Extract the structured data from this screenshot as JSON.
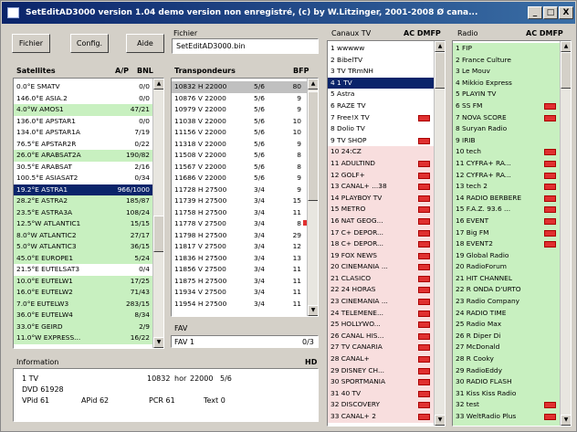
{
  "title": "SetEditAD3000 version 1.04 demo version non enregistré, (c) by W.Litzinger, 2001-2008 Ø cana...",
  "window_controls": {
    "min": "_",
    "max": "□",
    "close": "X"
  },
  "toolbar": {
    "fichier": "Fichier",
    "config": "Config.",
    "aide": "Aide"
  },
  "file": {
    "label": "Fichier",
    "value": "SetEditAD3000.bin"
  },
  "satellites": {
    "header": "Satellites",
    "col_ap": "A/P",
    "col_bl": "BNL",
    "rows": [
      {
        "name": "0.0°E SMATV",
        "value": "0/0",
        "style": ""
      },
      {
        "name": "146.0°E ASIA.2",
        "value": "0/0",
        "style": ""
      },
      {
        "name": "4.0°W AMOS1",
        "value": "47/21",
        "style": "green"
      },
      {
        "name": "136.0°E APSTAR1",
        "value": "0/0",
        "style": ""
      },
      {
        "name": "134.0°E APSTAR1A",
        "value": "7/19",
        "style": ""
      },
      {
        "name": "76.5°E APSTAR2R",
        "value": "0/22",
        "style": ""
      },
      {
        "name": "26.0°E ARABSAT2A",
        "value": "190/82",
        "style": "green"
      },
      {
        "name": "30.5°E ARABSAT",
        "value": "2/16",
        "style": ""
      },
      {
        "name": "100.5°E ASIASAT2",
        "value": "0/34",
        "style": ""
      },
      {
        "name": "19.2°E ASTRA1",
        "value": "966/1000",
        "style": "sel"
      },
      {
        "name": "28.2°E ASTRA2",
        "value": "185/87",
        "style": "green"
      },
      {
        "name": "23.5°E ASTRA3A",
        "value": "108/24",
        "style": "green"
      },
      {
        "name": "12.5°W ATLANTIC1",
        "value": "15/15",
        "style": "green"
      },
      {
        "name": "8.0°W ATLANTIC2",
        "value": "27/17",
        "style": "green"
      },
      {
        "name": "5.0°W ATLANTIC3",
        "value": "36/15",
        "style": "green"
      },
      {
        "name": "45.0°E EUROPE1",
        "value": "5/24",
        "style": "green"
      },
      {
        "name": "21.5°E EUTELSAT3",
        "value": "0/4",
        "style": ""
      },
      {
        "name": "10.0°E EUTELW1",
        "value": "17/25",
        "style": "green"
      },
      {
        "name": "16.0°E EUTELW2",
        "value": "71/43",
        "style": "green"
      },
      {
        "name": "7.0°E EUTELW3",
        "value": "283/15",
        "style": "green"
      },
      {
        "name": "36.0°E EUTELW4",
        "value": "8/34",
        "style": "green"
      },
      {
        "name": "33.0°E GEIRD",
        "value": "2/9",
        "style": "green"
      },
      {
        "name": "11.0°W EXPRESS...",
        "value": "16/22",
        "style": "green"
      }
    ]
  },
  "transponders": {
    "header": "Transpondeurs",
    "col_bfp": "BFP",
    "rows": [
      {
        "freq": "10832 H 22000",
        "fec": "5/6",
        "n": "80",
        "style": "grey"
      },
      {
        "freq": "10876 V 22000",
        "fec": "5/6",
        "n": "9",
        "style": ""
      },
      {
        "freq": "10979 V 22000",
        "fec": "5/6",
        "n": "9",
        "style": ""
      },
      {
        "freq": "11038 V 22000",
        "fec": "5/6",
        "n": "10",
        "style": ""
      },
      {
        "freq": "11156 V 22000",
        "fec": "5/6",
        "n": "10",
        "style": ""
      },
      {
        "freq": "11318 V 22000",
        "fec": "5/6",
        "n": "9",
        "style": ""
      },
      {
        "freq": "11508 V 22000",
        "fec": "5/6",
        "n": "8",
        "style": ""
      },
      {
        "freq": "11567 V 22000",
        "fec": "5/6",
        "n": "8",
        "style": ""
      },
      {
        "freq": "11686 V 22000",
        "fec": "5/6",
        "n": "9",
        "style": ""
      },
      {
        "freq": "11728 H 27500",
        "fec": "3/4",
        "n": "9",
        "style": ""
      },
      {
        "freq": "11739 H 27500",
        "fec": "3/4",
        "n": "15",
        "style": ""
      },
      {
        "freq": "11758 H 27500",
        "fec": "3/4",
        "n": "11",
        "style": ""
      },
      {
        "freq": "11778 V 27500",
        "fec": "3/4",
        "n": "8",
        "style": "flag"
      },
      {
        "freq": "11798 H 27500",
        "fec": "3/4",
        "n": "29",
        "style": ""
      },
      {
        "freq": "11817 V 27500",
        "fec": "3/4",
        "n": "12",
        "style": ""
      },
      {
        "freq": "11836 H 27500",
        "fec": "3/4",
        "n": "13",
        "style": ""
      },
      {
        "freq": "11856 V 27500",
        "fec": "3/4",
        "n": "11",
        "style": ""
      },
      {
        "freq": "11875 H 27500",
        "fec": "3/4",
        "n": "11",
        "style": ""
      },
      {
        "freq": "11934 V 27500",
        "fec": "3/4",
        "n": "11",
        "style": ""
      },
      {
        "freq": "11954 H 27500",
        "fec": "3/4",
        "n": "11",
        "style": ""
      }
    ]
  },
  "fav": {
    "label": "FAV",
    "value": "FAV 1",
    "count": "0/3"
  },
  "info": {
    "label": "Information",
    "hd": "HD",
    "line1": {
      "name": "1 TV",
      "freq": "10832",
      "pol": "hor",
      "sr": "22000",
      "fec": "5/6"
    },
    "line2": "DVD 61928",
    "line3": {
      "vpid": "VPid 61",
      "apid": "APid 62",
      "pcr": "PCR 61",
      "text": "Text 0"
    }
  },
  "tv": {
    "header": "Canaux TV",
    "cols": "AC DMFP",
    "rows": [
      {
        "name": "1 wwwww",
        "style": "",
        "red": false
      },
      {
        "name": "2 BibelTV",
        "style": "",
        "red": false
      },
      {
        "name": "3 TV TRmNH",
        "style": "",
        "red": false
      },
      {
        "name": "4 1 TV",
        "style": "sel",
        "red": false
      },
      {
        "name": "5 Astra",
        "style": "",
        "red": false
      },
      {
        "name": "6 RAZE TV",
        "style": "",
        "red": false
      },
      {
        "name": "7 Free!X TV",
        "style": "",
        "red": true
      },
      {
        "name": "8 Dolio TV",
        "style": "",
        "red": false
      },
      {
        "name": "9 TV SHOP",
        "style": "",
        "red": true
      },
      {
        "name": "10 24:CZ",
        "style": "pink",
        "red": false
      },
      {
        "name": "11 ADULTIND",
        "style": "pink",
        "red": true
      },
      {
        "name": "12 GOLF+",
        "style": "pink",
        "red": true
      },
      {
        "name": "13 CANAL+ ...38",
        "style": "pink",
        "red": true
      },
      {
        "name": "14 PLAYBOY TV",
        "style": "pink",
        "red": true
      },
      {
        "name": "15 METRO",
        "style": "pink",
        "red": true
      },
      {
        "name": "16 NAT GEOG...",
        "style": "pink",
        "red": true
      },
      {
        "name": "17 C+ DEPOR...",
        "style": "pink",
        "red": true
      },
      {
        "name": "18 C+ DEPOR...",
        "style": "pink",
        "red": true
      },
      {
        "name": "19 FOX NEWS",
        "style": "pink",
        "red": true
      },
      {
        "name": "20 CINEMANIA ...",
        "style": "pink",
        "red": true
      },
      {
        "name": "21 CLASICO",
        "style": "pink",
        "red": true
      },
      {
        "name": "22 24 HORAS",
        "style": "pink",
        "red": true
      },
      {
        "name": "23 CINEMANIA ...",
        "style": "pink",
        "red": true
      },
      {
        "name": "24 TELEMENE...",
        "style": "pink",
        "red": true
      },
      {
        "name": "25 HOLLYWO...",
        "style": "pink",
        "red": true
      },
      {
        "name": "26 CANAL HIS...",
        "style": "pink",
        "red": true
      },
      {
        "name": "27 TV CANARIA",
        "style": "pink",
        "red": true
      },
      {
        "name": "28 CANAL+",
        "style": "pink",
        "red": true
      },
      {
        "name": "29 DISNEY CH...",
        "style": "pink",
        "red": true
      },
      {
        "name": "30 SPORTMANIA",
        "style": "pink",
        "red": true
      },
      {
        "name": "31 40 TV",
        "style": "pink",
        "red": true
      },
      {
        "name": "32 DISCOVERY",
        "style": "pink",
        "red": true
      },
      {
        "name": "33 CANAL+ 2",
        "style": "pink",
        "red": true
      }
    ]
  },
  "radio": {
    "header": "Radio",
    "cols": "AC DMFP",
    "rows": [
      {
        "name": "1 FIP",
        "red": false
      },
      {
        "name": "2 France Culture",
        "red": false
      },
      {
        "name": "3 Le Mouv",
        "red": false
      },
      {
        "name": "4 Mikkio Express",
        "red": false
      },
      {
        "name": "5 PLAYIN TV",
        "red": false
      },
      {
        "name": "6 SS FM",
        "red": true
      },
      {
        "name": "7 NOVA SCORE",
        "red": true
      },
      {
        "name": "8 Suryan Radio",
        "red": false
      },
      {
        "name": "9 IRIB",
        "red": false
      },
      {
        "name": "10 tech",
        "red": true
      },
      {
        "name": "11 CYFRA+ RA...",
        "red": true
      },
      {
        "name": "12 CYFRA+ RA...",
        "red": true
      },
      {
        "name": "13 tech 2",
        "red": true
      },
      {
        "name": "14 RADIO BERBERE",
        "red": true
      },
      {
        "name": "15 F.A.Z. 93.6 ...",
        "red": true
      },
      {
        "name": "16 EVENT",
        "red": true
      },
      {
        "name": "17 Big FM",
        "red": true
      },
      {
        "name": "18 EVENT2",
        "red": true
      },
      {
        "name": "19 Global Radio",
        "red": false
      },
      {
        "name": "20 RadioForum",
        "red": false
      },
      {
        "name": "21 HIT CHANNEL",
        "red": false
      },
      {
        "name": "22 R ONDA D'URTO",
        "red": false
      },
      {
        "name": "23 Radio Company",
        "red": false
      },
      {
        "name": "24 RADIO TIME",
        "red": false
      },
      {
        "name": "25 Radio Max",
        "red": false
      },
      {
        "name": "26 R Diper Di",
        "red": false
      },
      {
        "name": "27 McDonald",
        "red": false
      },
      {
        "name": "28 R Cooky",
        "red": false
      },
      {
        "name": "29 RadioEddy",
        "red": false
      },
      {
        "name": "30 RADIO FLASH",
        "red": false
      },
      {
        "name": "31 Kiss Kiss Radio",
        "red": false
      },
      {
        "name": "32 test",
        "red": true
      },
      {
        "name": "33 WeltRadio Plus",
        "red": true
      }
    ]
  }
}
